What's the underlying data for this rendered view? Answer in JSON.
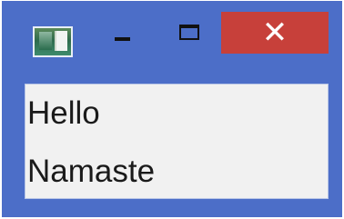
{
  "window": {
    "title_icon": "app-icon",
    "controls": {
      "minimize_icon": "minimize-icon",
      "maximize_icon": "maximize-icon",
      "close_glyph": "✕",
      "close_color": "#c7403a"
    },
    "frame_color": "#4c6ec8"
  },
  "content": {
    "labels": [
      "Hello",
      "Namaste"
    ]
  }
}
